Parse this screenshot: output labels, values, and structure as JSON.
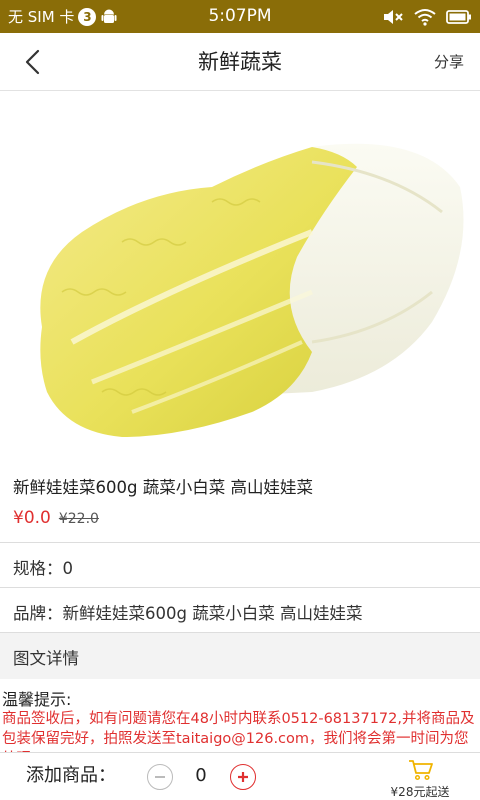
{
  "status_bar": {
    "carrier": "无 SIM 卡",
    "notif_count": "3",
    "time": "5:07PM"
  },
  "header": {
    "title": "新鲜蔬菜",
    "share_label": "分享"
  },
  "product": {
    "name": "新鲜娃娃菜600g 蔬菜小白菜 高山娃娃菜",
    "price": "¥0.0",
    "original_price": "¥22.0",
    "spec": "规格：0",
    "brand": "品牌：新鲜娃娃菜600g 蔬菜小白菜 高山娃娃菜",
    "details_label": "图文详情"
  },
  "notice": {
    "title": "温馨提示:",
    "text": "商品签收后，如有问题请您在48小时内联系0512-68137172,并将商品及包装保留完好，拍照发送至taitaigo@126.com，我们将会第一时间为您处理。"
  },
  "bottom_bar": {
    "add_label": "添加商品：",
    "quantity": "0",
    "cart_min_label": "¥28元起送"
  },
  "colors": {
    "status_bar_bg": "#8a6d08",
    "accent_red": "#e03030",
    "cart_yellow": "#f0b400"
  }
}
